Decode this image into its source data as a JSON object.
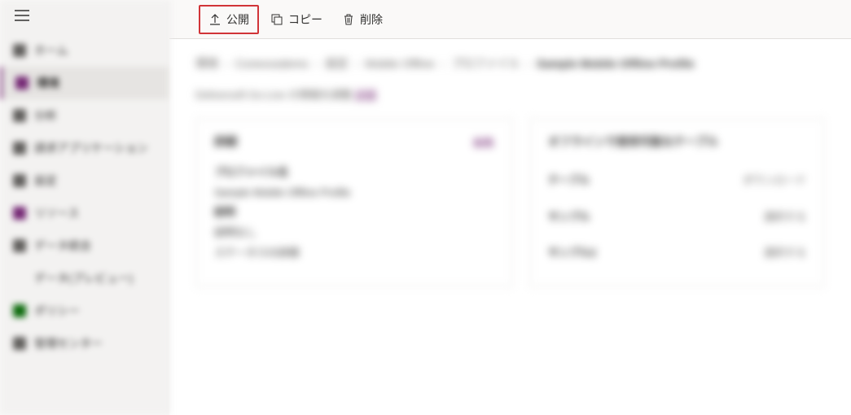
{
  "sidebar": {
    "items": [
      {
        "label": "ホーム"
      },
      {
        "label": "環境"
      },
      {
        "label": "分析"
      },
      {
        "label": "請求アプリケーション"
      },
      {
        "label": "設定"
      },
      {
        "label": "リソース"
      },
      {
        "label": "データ統合"
      },
      {
        "label": "データ(プレビュー)"
      },
      {
        "label": "ポリシー"
      },
      {
        "label": "管理センター"
      }
    ]
  },
  "toolbar": {
    "publish": "公開",
    "copy": "コピー",
    "delete": "削除"
  },
  "breadcrumb": {
    "items": [
      "環境",
      "Conexosdemo",
      "設定",
      "Mobile Offline",
      "プロファイル"
    ],
    "current": "Sample Mobile Offline Profile"
  },
  "subtitle": {
    "text": "Deliversoft Go-Live の情報を調整",
    "link": "詳細"
  },
  "left_panel": {
    "title": "詳細",
    "edit": "編集",
    "field1_label": "プロファイル名",
    "field1_value": "Sample Mobile Offline Profile",
    "field2_label": "説明",
    "field2_value": "説明なし",
    "status_label": "ステータスの詳細"
  },
  "right_panel": {
    "title": "オフラインで使用可能なテーブル",
    "rows": [
      {
        "name": "テーブル",
        "status": "ダウンロード"
      },
      {
        "name": "サンプル",
        "status": "選択する"
      },
      {
        "name": "サンプル2",
        "status": "選択する"
      }
    ]
  }
}
